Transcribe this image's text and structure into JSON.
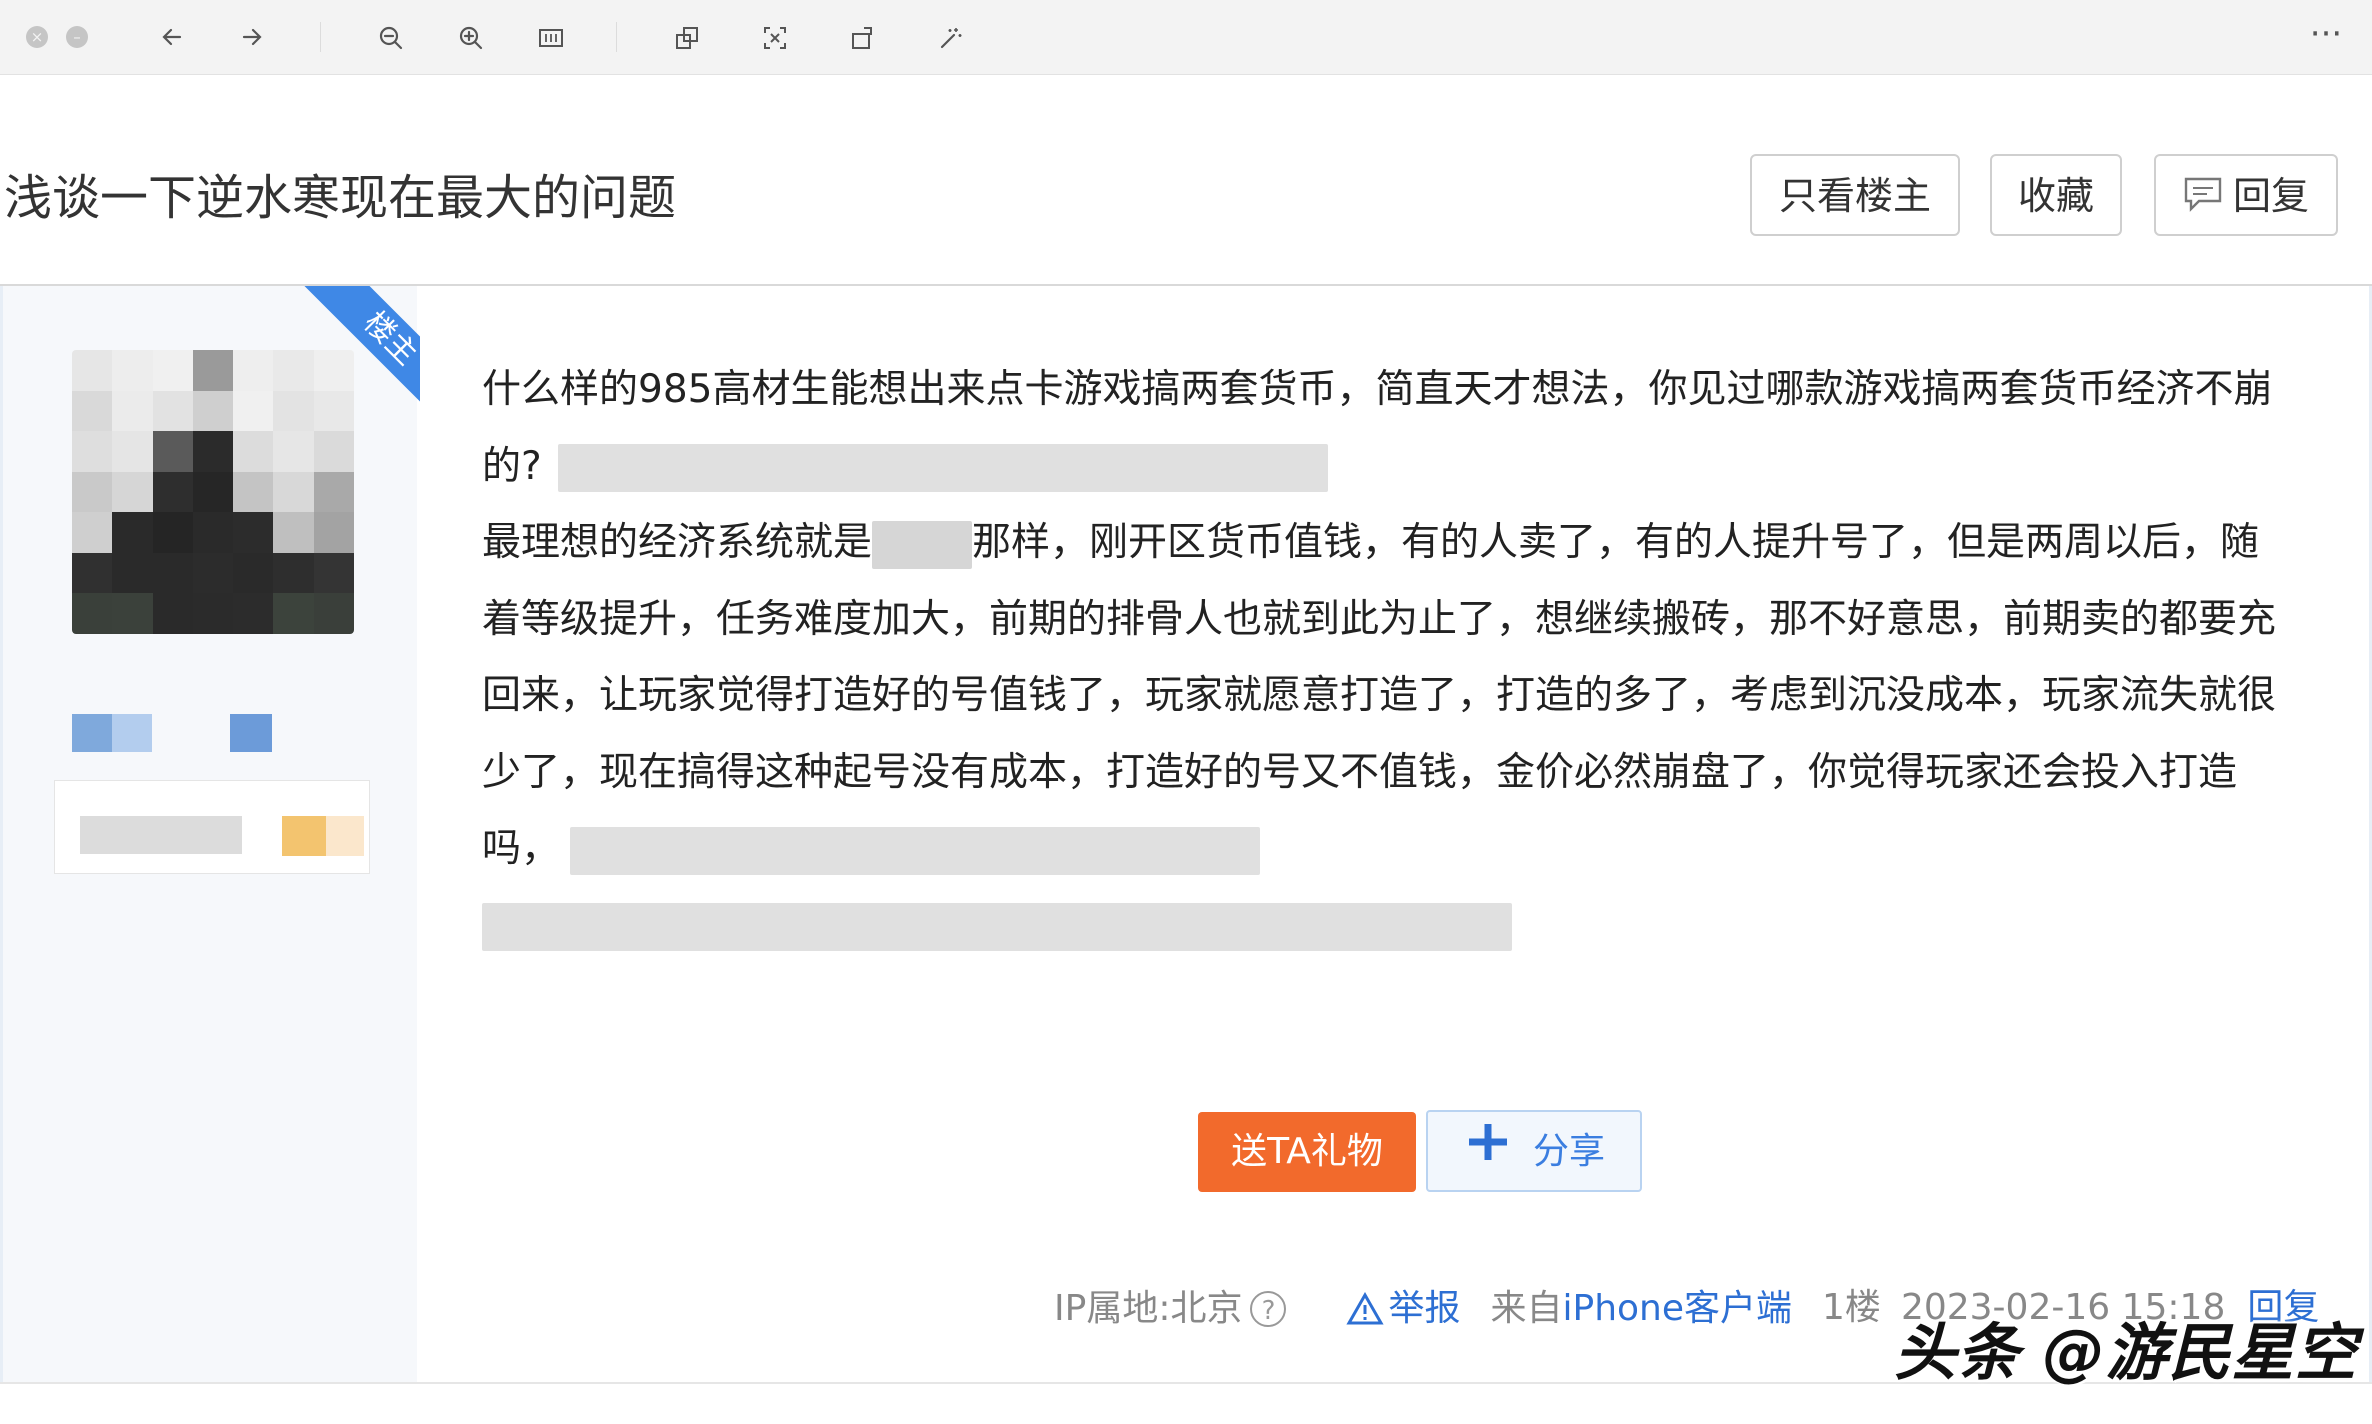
{
  "toolbar": {
    "close_icon": "close-icon",
    "minimize_icon": "minimize-icon",
    "more_label": "···",
    "icons": [
      "back-arrow-icon",
      "forward-arrow-icon",
      "zoom-out-icon",
      "zoom-in-icon",
      "fit-screen-icon",
      "crop-icon",
      "select-region-icon",
      "rotate-icon",
      "magic-wand-icon"
    ]
  },
  "thread": {
    "title": "浅谈一下逆水寒现在最大的问题",
    "buttons": {
      "only_op": "只看楼主",
      "favorite": "收藏",
      "reply": "回复"
    }
  },
  "author": {
    "badge": "楼主"
  },
  "post": {
    "paragraph1": "什么样的985高材生能想出来点卡游戏搞两套货币，简直天才想法，你见过哪款游戏搞两套货币经济不崩的?",
    "paragraph2_before": "最理想的经济系统就是",
    "paragraph2_after": "那样，刚开区货币值钱，有的人卖了，有的人提升号了，但是两周以后，随着等级提升，任务难度加大，前期的排骨人也就到此为止了，想继续搬砖，那不好意思，前期卖的都要充回来，让玩家觉得打造好的号值钱了，玩家就愿意打造了，打造的多了，考虑到沉没成本，玩家流失就很少了，现在搞得这种起号没有成本，打造好的号又不值钱，金价必然崩盘了，你觉得玩家还会投入打造吗，",
    "gift_button": "送TA礼物",
    "share_button": "分享",
    "meta": {
      "ip": "IP属地:北京",
      "report": "举报",
      "source_prefix": "来自",
      "source_client": "iPhone客户端",
      "floor": "1楼",
      "datetime": "2023-02-16 15:18",
      "reply": "回复"
    }
  },
  "watermark": "头条 @游民星空",
  "colors": {
    "accent_blue": "#3f88e6",
    "gift_orange": "#f26a2c",
    "link_blue": "#2d6fd3"
  }
}
